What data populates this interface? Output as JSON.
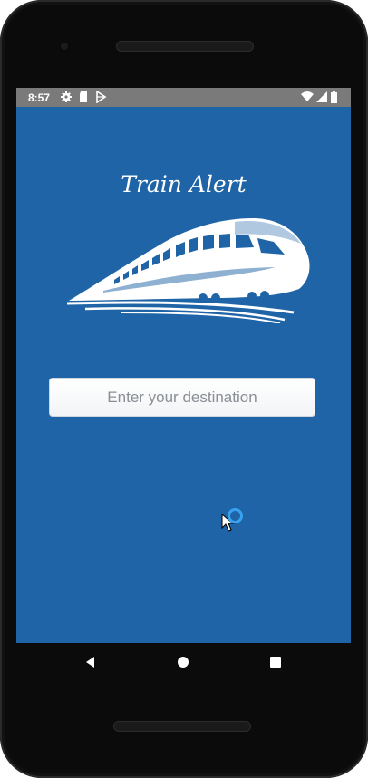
{
  "status_bar": {
    "time": "8:57",
    "left_icons": [
      "settings-icon",
      "sd-card-icon",
      "play-store-icon"
    ],
    "right_icons": [
      "wifi-icon",
      "signal-icon",
      "battery-icon"
    ]
  },
  "app": {
    "title": "Train Alert",
    "logo": "train-icon"
  },
  "destination": {
    "placeholder": "Enter your destination",
    "value": ""
  },
  "navigation": {
    "buttons": [
      "back-icon",
      "home-icon",
      "recents-icon"
    ]
  },
  "colors": {
    "background": "#1e64a6",
    "status_bar": "#7a7a7a",
    "text": "#ffffff",
    "input_background": "#ffffff",
    "input_placeholder": "#8a8f96"
  }
}
